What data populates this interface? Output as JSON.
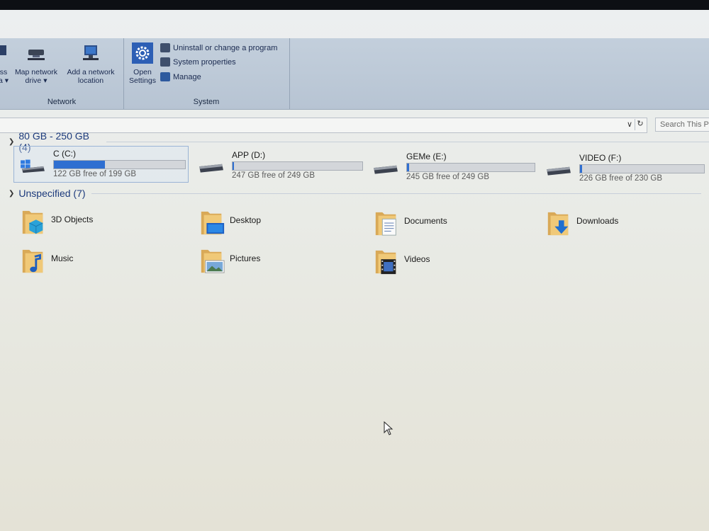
{
  "ribbon": {
    "network": {
      "label": "Network",
      "partial_button": {
        "line1": "ss",
        "line2": "a ▾"
      },
      "map_drive": {
        "line1": "Map network",
        "line2": "drive ▾"
      },
      "add_location": {
        "line1": "Add a network",
        "line2": "location"
      }
    },
    "system": {
      "label": "System",
      "open_settings": {
        "line1": "Open",
        "line2": "Settings"
      },
      "uninstall": "Uninstall or change a program",
      "system_properties": "System properties",
      "manage": "Manage"
    }
  },
  "address": {
    "dropdown_glyph": "∨",
    "refresh_glyph": "↻"
  },
  "search": {
    "placeholder": "Search This PC"
  },
  "groups": {
    "drives_header": "80 GB - 250 GB (4)",
    "folders_header": "Unspecified (7)"
  },
  "drives": [
    {
      "name": "C (C:)",
      "free": "122 GB free of 199 GB",
      "used_fraction": 0.387,
      "icon": "windows-drive-icon"
    },
    {
      "name": "APP (D:)",
      "free": "247 GB free of 249 GB",
      "used_fraction": 0.008,
      "icon": "hard-drive-icon"
    },
    {
      "name": "GEMe (E:)",
      "free": "245 GB free of 249 GB",
      "used_fraction": 0.016,
      "icon": "hard-drive-icon"
    },
    {
      "name": "VIDEO (F:)",
      "free": "226 GB free of 230 GB",
      "used_fraction": 0.017,
      "icon": "hard-drive-icon"
    }
  ],
  "folders": [
    {
      "name": "3D Objects",
      "icon": "3d-objects-folder-icon"
    },
    {
      "name": "Desktop",
      "icon": "desktop-folder-icon"
    },
    {
      "name": "Documents",
      "icon": "documents-folder-icon"
    },
    {
      "name": "Downloads",
      "icon": "downloads-folder-icon"
    },
    {
      "name": "Music",
      "icon": "music-folder-icon"
    },
    {
      "name": "Pictures",
      "icon": "pictures-folder-icon"
    },
    {
      "name": "Videos",
      "icon": "videos-folder-icon"
    }
  ],
  "colors": {
    "ribbon_bg": "#bfcbd9",
    "accent_blue": "#2f6fd1",
    "header_text": "#1c3a7c",
    "folder_yellow": "#e7bd6a"
  }
}
